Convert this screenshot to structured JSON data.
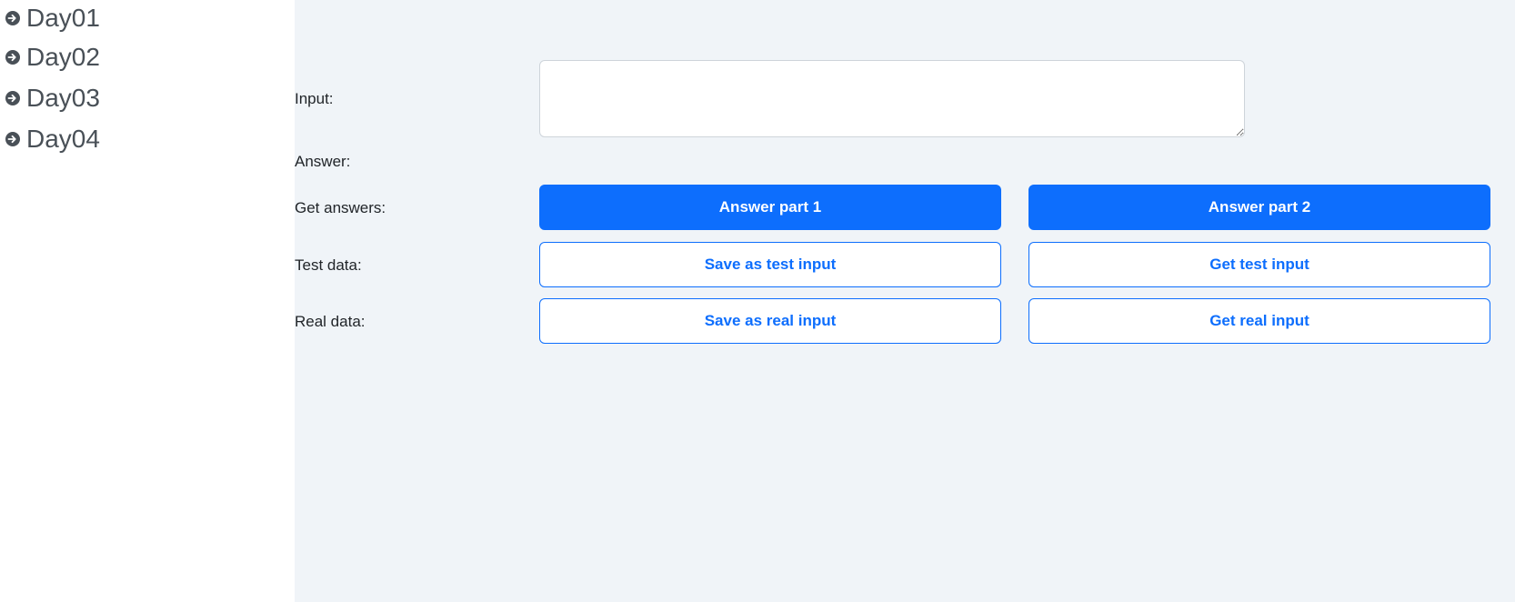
{
  "sidebar": {
    "items": [
      {
        "label": "Day01",
        "icon": "arrow-right-circle-icon"
      },
      {
        "label": "Day02",
        "icon": "arrow-right-circle-icon"
      },
      {
        "label": "Day03",
        "icon": "arrow-right-circle-icon"
      },
      {
        "label": "Day04",
        "icon": "arrow-right-circle-icon"
      }
    ]
  },
  "form": {
    "input_label": "Input:",
    "input_value": "",
    "answer_label": "Answer:",
    "get_answers_label": "Get answers:",
    "test_data_label": "Test data:",
    "real_data_label": "Real data:"
  },
  "buttons": {
    "answer_part1": "Answer part 1",
    "answer_part2": "Answer part 2",
    "save_test_input": "Save as test input",
    "get_test_input": "Get test input",
    "save_real_input": "Save as real input",
    "get_real_input": "Get real input"
  },
  "colors": {
    "accent": "#0d6efd",
    "main_background": "#f0f4f8",
    "sidebar_background": "#ffffff",
    "nav_text": "#495057"
  }
}
